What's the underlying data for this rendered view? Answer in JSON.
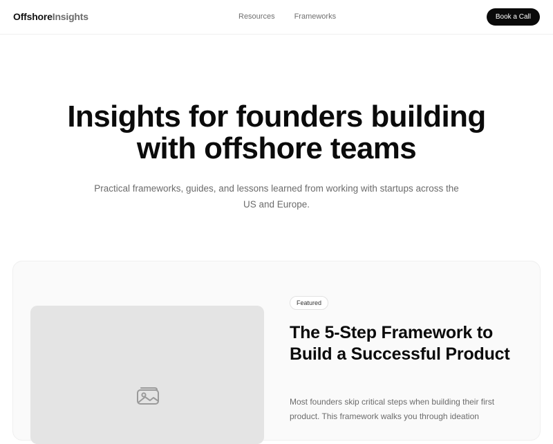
{
  "header": {
    "logo_primary": "Offshore",
    "logo_secondary": "Insights",
    "nav": [
      {
        "label": "Resources"
      },
      {
        "label": "Frameworks"
      }
    ],
    "cta_label": "Book a Call"
  },
  "hero": {
    "title_line1": "Insights for founders building",
    "title_line2": "with offshore teams",
    "subtitle": "Practical frameworks, guides, and lessons learned from working with startups across the US and Europe."
  },
  "featured": {
    "badge": "Featured",
    "title": "The 5-Step Framework to Build a Successful Product",
    "excerpt": "Most founders skip critical steps when building their first product. This framework walks you through ideation",
    "image_icon": "image-icon"
  },
  "colors": {
    "cta_bg": "#0a0a0a",
    "muted_text": "#6b6b6b",
    "card_bg": "#fafafa",
    "thumb_bg": "#e4e4e4"
  }
}
